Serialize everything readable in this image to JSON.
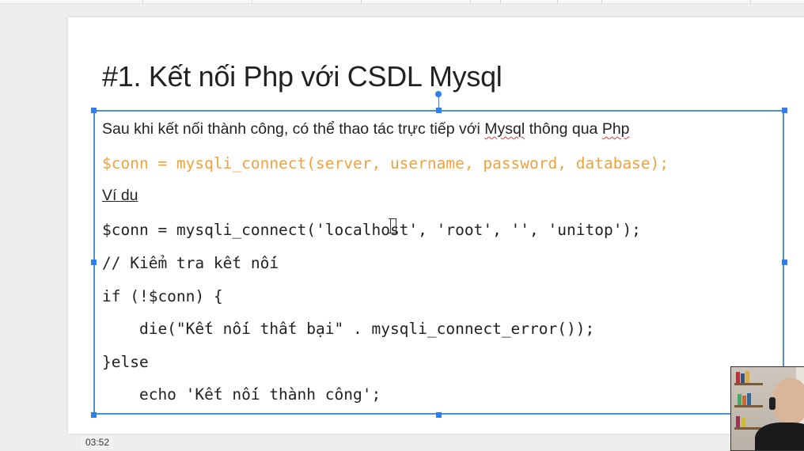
{
  "timestamp": "03:52",
  "slide": {
    "title": "#1. Kết nối Php với CSDL Mysql",
    "lines": {
      "intro_part1": "Sau khi kết nối thành công, có thể thao tác trực tiếp với ",
      "intro_mysql": "Mysql",
      "intro_part2": " thông qua ",
      "intro_php": "Php",
      "syntax": "$conn = mysqli_connect(server, username, password, database);",
      "example_label": "Ví du",
      "code1": "$conn = mysqli_connect('localhost', 'root', '', 'unitop');",
      "code2": "// Kiểm tra kết nối",
      "code3": "if (!$conn) {",
      "code4": "    die(\"Kết nối thất bại\" . mysqli_connect_error());",
      "code5": "}else",
      "code6": "    echo 'Kết nối thành công';"
    }
  },
  "colors": {
    "selection": "#4a90e2",
    "syntax_highlight": "#f0a33b",
    "spellcheck": "#e53935"
  },
  "icons": {
    "text_cursor": "i-beam-cursor-icon"
  }
}
